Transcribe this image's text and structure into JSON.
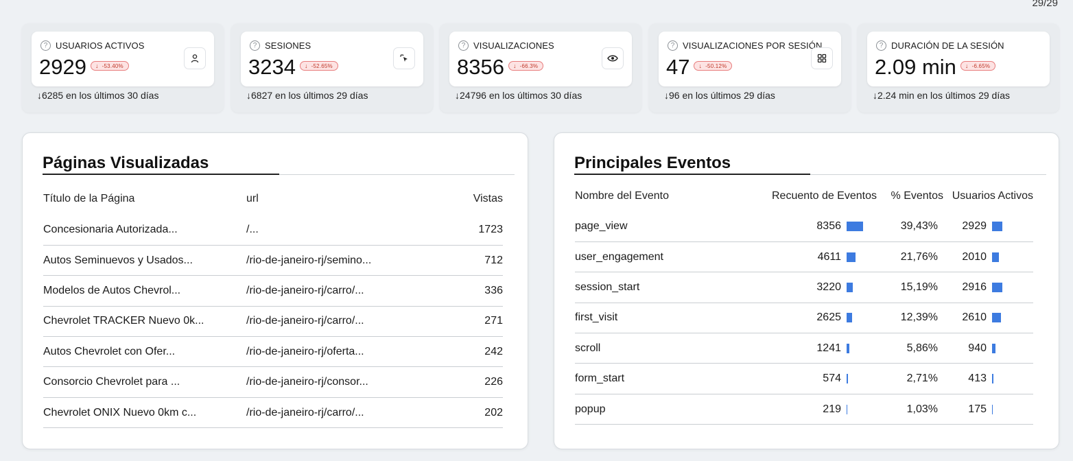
{
  "page_counter": "29/29",
  "kpis": [
    {
      "label": "USUARIOS ACTIVOS",
      "value": "2929",
      "change": "-53.40%",
      "icon": "user-icon",
      "footer": "↓6285 en los últimos 30 días"
    },
    {
      "label": "SESIONES",
      "value": "3234",
      "change": "-52.65%",
      "icon": "cursor-click-icon",
      "footer": "↓6827 en los últimos 29 días"
    },
    {
      "label": "VISUALIZACIONES",
      "value": "8356",
      "change": "-66.3%",
      "icon": "eye-icon",
      "footer": "↓24796 en los últimos 30 días"
    },
    {
      "label": "VISUALIZACIONES POR SESIÓN",
      "value": "47",
      "change": "-50.12%",
      "icon": "grid-icon",
      "footer": "↓96 en los últimos 29 días"
    },
    {
      "label": "DURACIÓN DE LA SESIÓN",
      "value": "2.09 min",
      "change": "-6.65%",
      "icon": "",
      "footer": "↓2.24 min en los últimos 29 días"
    }
  ],
  "pages_panel": {
    "title": "Páginas Visualizadas",
    "columns": [
      "Título de la Página",
      "url",
      "Vistas"
    ],
    "rows": [
      {
        "title": "Concesionaria Autorizada...",
        "url": "/...",
        "views": "1723"
      },
      {
        "title": "Autos Seminuevos y Usados...",
        "url": "/rio-de-janeiro-rj/semino...",
        "views": "712"
      },
      {
        "title": "Modelos de Autos Chevrol...",
        "url": "/rio-de-janeiro-rj/carro/...",
        "views": "336"
      },
      {
        "title": "Chevrolet TRACKER Nuevo 0k...",
        "url": "/rio-de-janeiro-rj/carro/...",
        "views": "271"
      },
      {
        "title": "Autos Chevrolet con Ofer...",
        "url": "/rio-de-janeiro-rj/oferta...",
        "views": "242"
      },
      {
        "title": "Consorcio Chevrolet para ...",
        "url": "/rio-de-janeiro-rj/consor...",
        "views": "226"
      },
      {
        "title": "Chevrolet ONIX Nuevo 0km c...",
        "url": "/rio-de-janeiro-rj/carro/...",
        "views": "202"
      }
    ]
  },
  "events_panel": {
    "title": "Principales Eventos",
    "columns": [
      "Nombre del Evento",
      "Recuento de Eventos",
      "% Eventos",
      "Usuarios Activos"
    ],
    "bar_color": "#3d7be0",
    "rows": [
      {
        "name": "page_view",
        "count": "8356",
        "count_value": 8356,
        "pct": "39,43%",
        "users": "2929",
        "users_value": 2929
      },
      {
        "name": "user_engagement",
        "count": "4611",
        "count_value": 4611,
        "pct": "21,76%",
        "users": "2010",
        "users_value": 2010
      },
      {
        "name": "session_start",
        "count": "3220",
        "count_value": 3220,
        "pct": "15,19%",
        "users": "2916",
        "users_value": 2916
      },
      {
        "name": "first_visit",
        "count": "2625",
        "count_value": 2625,
        "pct": "12,39%",
        "users": "2610",
        "users_value": 2610
      },
      {
        "name": "scroll",
        "count": "1241",
        "count_value": 1241,
        "pct": "5,86%",
        "users": "940",
        "users_value": 940
      },
      {
        "name": "form_start",
        "count": "574",
        "count_value": 574,
        "pct": "2,71%",
        "users": "413",
        "users_value": 413
      },
      {
        "name": "popup",
        "count": "219",
        "count_value": 219,
        "pct": "1,03%",
        "users": "175",
        "users_value": 175
      }
    ]
  }
}
